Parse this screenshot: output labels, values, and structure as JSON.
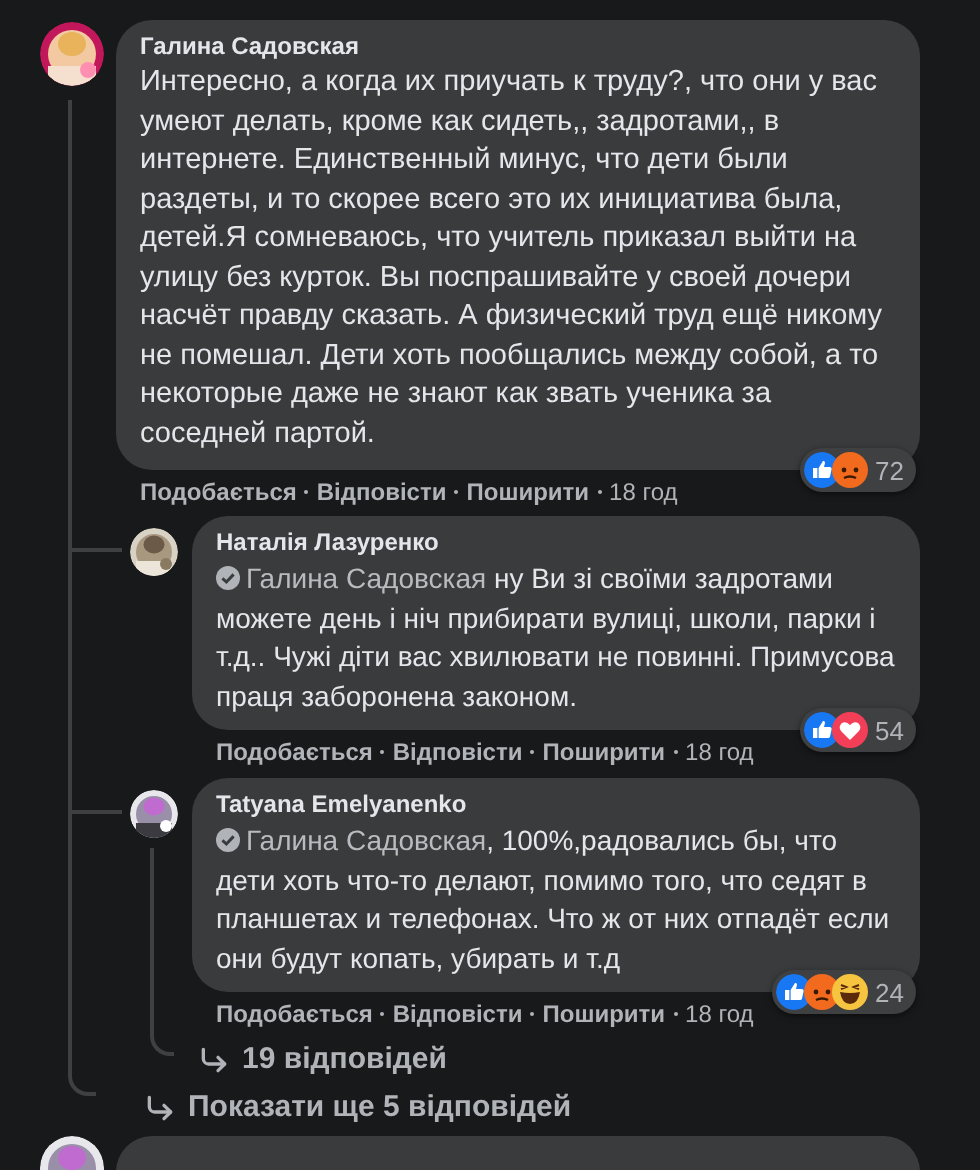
{
  "comment": {
    "author": "Галина Садовская",
    "text": "Интересно, а когда их приучать к труду?, что они у вас умеют делать, кроме как сидеть,, задротами,, в интернете. Единственный минус, что дети были раздеты, и то скорее всего это их инициатива была, детей.Я сомневаюсь, что учитель приказал выйти на улицу без курток. Вы поспрашивайте у своей дочери насчёт правду сказать. А физический труд ещё никому не помешал. Дети хоть пообщались между собой, а то некоторые даже не знают как звать ученика за соседней партой.",
    "reactions": {
      "icons": [
        {
          "kind": "like"
        },
        {
          "kind": "angry"
        }
      ],
      "count": "72"
    },
    "actions": {
      "like": "Подобається",
      "reply": "Відповісти",
      "share": "Поширити",
      "time": "18 год"
    },
    "replies": [
      {
        "author": "Наталія Лазуренко",
        "mention": "Галина Садовская",
        "text": " ну Ви зі своїми задротами можете день і ніч прибирати вулиці, школи, парки і т.д.. Чужі діти вас хвилювати не повинні. Примусова праця заборонена законом.",
        "reactions": {
          "icons": [
            {
              "kind": "like"
            },
            {
              "kind": "love"
            }
          ],
          "count": "54"
        },
        "actions": {
          "like": "Подобається",
          "reply": "Відповісти",
          "share": "Поширити",
          "time": "18 год"
        }
      },
      {
        "author": "Tatyana Emelyanenko",
        "mention": "Галина Садовская",
        "text": ", 100%,радовались бы, что дети хоть что-то делают, помимо того, что седят в планшетах и телефонах. Что ж от них отпадёт если они будут копать, убирать и т.д",
        "reactions": {
          "icons": [
            {
              "kind": "like"
            },
            {
              "kind": "angry"
            },
            {
              "kind": "haha"
            }
          ],
          "count": "24"
        },
        "actions": {
          "like": "Подобається",
          "reply": "Відповісти",
          "share": "Поширити",
          "time": "18 год"
        },
        "replies_link": "19 відповідей"
      }
    ],
    "more_link": "Показати ще 5 відповідей"
  }
}
